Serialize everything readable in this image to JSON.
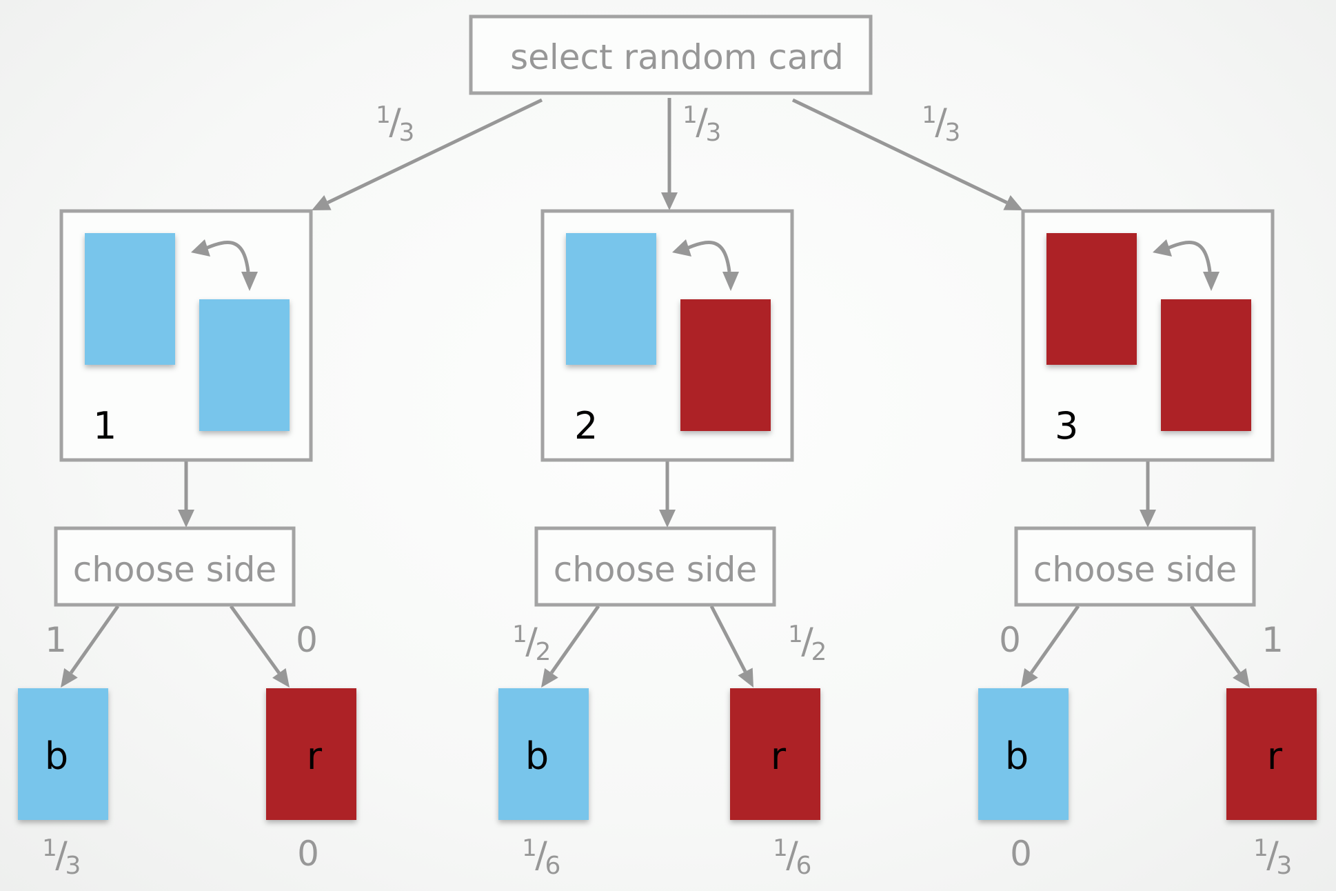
{
  "colors": {
    "blue": "#78c5eb",
    "red": "#ad2228",
    "line": "#979797",
    "border": "#a3a3a3",
    "text_gray": "#979797",
    "text_dark": "#000000"
  },
  "root": {
    "label": "select random card"
  },
  "root_branches": [
    {
      "num": "1",
      "den": "3"
    },
    {
      "num": "1",
      "den": "3"
    },
    {
      "num": "1",
      "den": "3"
    }
  ],
  "cards": [
    {
      "number": "1",
      "faces": [
        "blue",
        "blue"
      ]
    },
    {
      "number": "2",
      "faces": [
        "blue",
        "red"
      ]
    },
    {
      "number": "3",
      "faces": [
        "red",
        "red"
      ]
    }
  ],
  "choose": [
    {
      "label": "choose side",
      "branches": [
        {
          "type": "plain",
          "text": "1"
        },
        {
          "type": "plain",
          "text": "0"
        }
      ],
      "leaves": [
        {
          "letter": "b",
          "color": "blue",
          "result": {
            "type": "frac",
            "num": "1",
            "den": "3"
          }
        },
        {
          "letter": "r",
          "color": "red",
          "result": {
            "type": "plain",
            "text": "0"
          }
        }
      ]
    },
    {
      "label": "choose side",
      "branches": [
        {
          "type": "frac",
          "num": "1",
          "den": "2"
        },
        {
          "type": "frac",
          "num": "1",
          "den": "2"
        }
      ],
      "leaves": [
        {
          "letter": "b",
          "color": "blue",
          "result": {
            "type": "frac",
            "num": "1",
            "den": "6"
          }
        },
        {
          "letter": "r",
          "color": "red",
          "result": {
            "type": "frac",
            "num": "1",
            "den": "6"
          }
        }
      ]
    },
    {
      "label": "choose side",
      "branches": [
        {
          "type": "plain",
          "text": "0"
        },
        {
          "type": "plain",
          "text": "1"
        }
      ],
      "leaves": [
        {
          "letter": "b",
          "color": "blue",
          "result": {
            "type": "plain",
            "text": "0"
          }
        },
        {
          "letter": "r",
          "color": "red",
          "result": {
            "type": "frac",
            "num": "1",
            "den": "3"
          }
        }
      ]
    }
  ]
}
